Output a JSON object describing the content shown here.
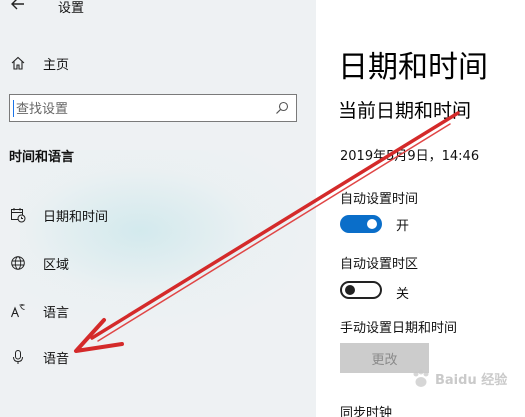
{
  "app": {
    "title": "设置"
  },
  "sidebar": {
    "home_label": "主页",
    "search_placeholder": "查找设置",
    "section_title": "时间和语言",
    "items": [
      {
        "label": "日期和时间",
        "icon": "calendar-clock-icon"
      },
      {
        "label": "区域",
        "icon": "globe-region-icon"
      },
      {
        "label": "语言",
        "icon": "language-icon"
      },
      {
        "label": "语音",
        "icon": "microphone-icon"
      }
    ]
  },
  "main": {
    "page_title": "日期和时间",
    "current_section": "当前日期和时间",
    "current_datetime": "2019年5月9日，14:46",
    "auto_time": {
      "label": "自动设置时间",
      "state": "开",
      "on": true
    },
    "auto_timezone": {
      "label": "自动设置时区",
      "state": "关",
      "on": false
    },
    "manual": {
      "label": "手动设置日期和时间",
      "button": "更改"
    },
    "sync_title": "同步时钟"
  },
  "annotation": {
    "arrow_color": "#d42a2a"
  },
  "colors": {
    "accent": "#0a6ec9",
    "sidebar_bg": "#eef1f3"
  }
}
